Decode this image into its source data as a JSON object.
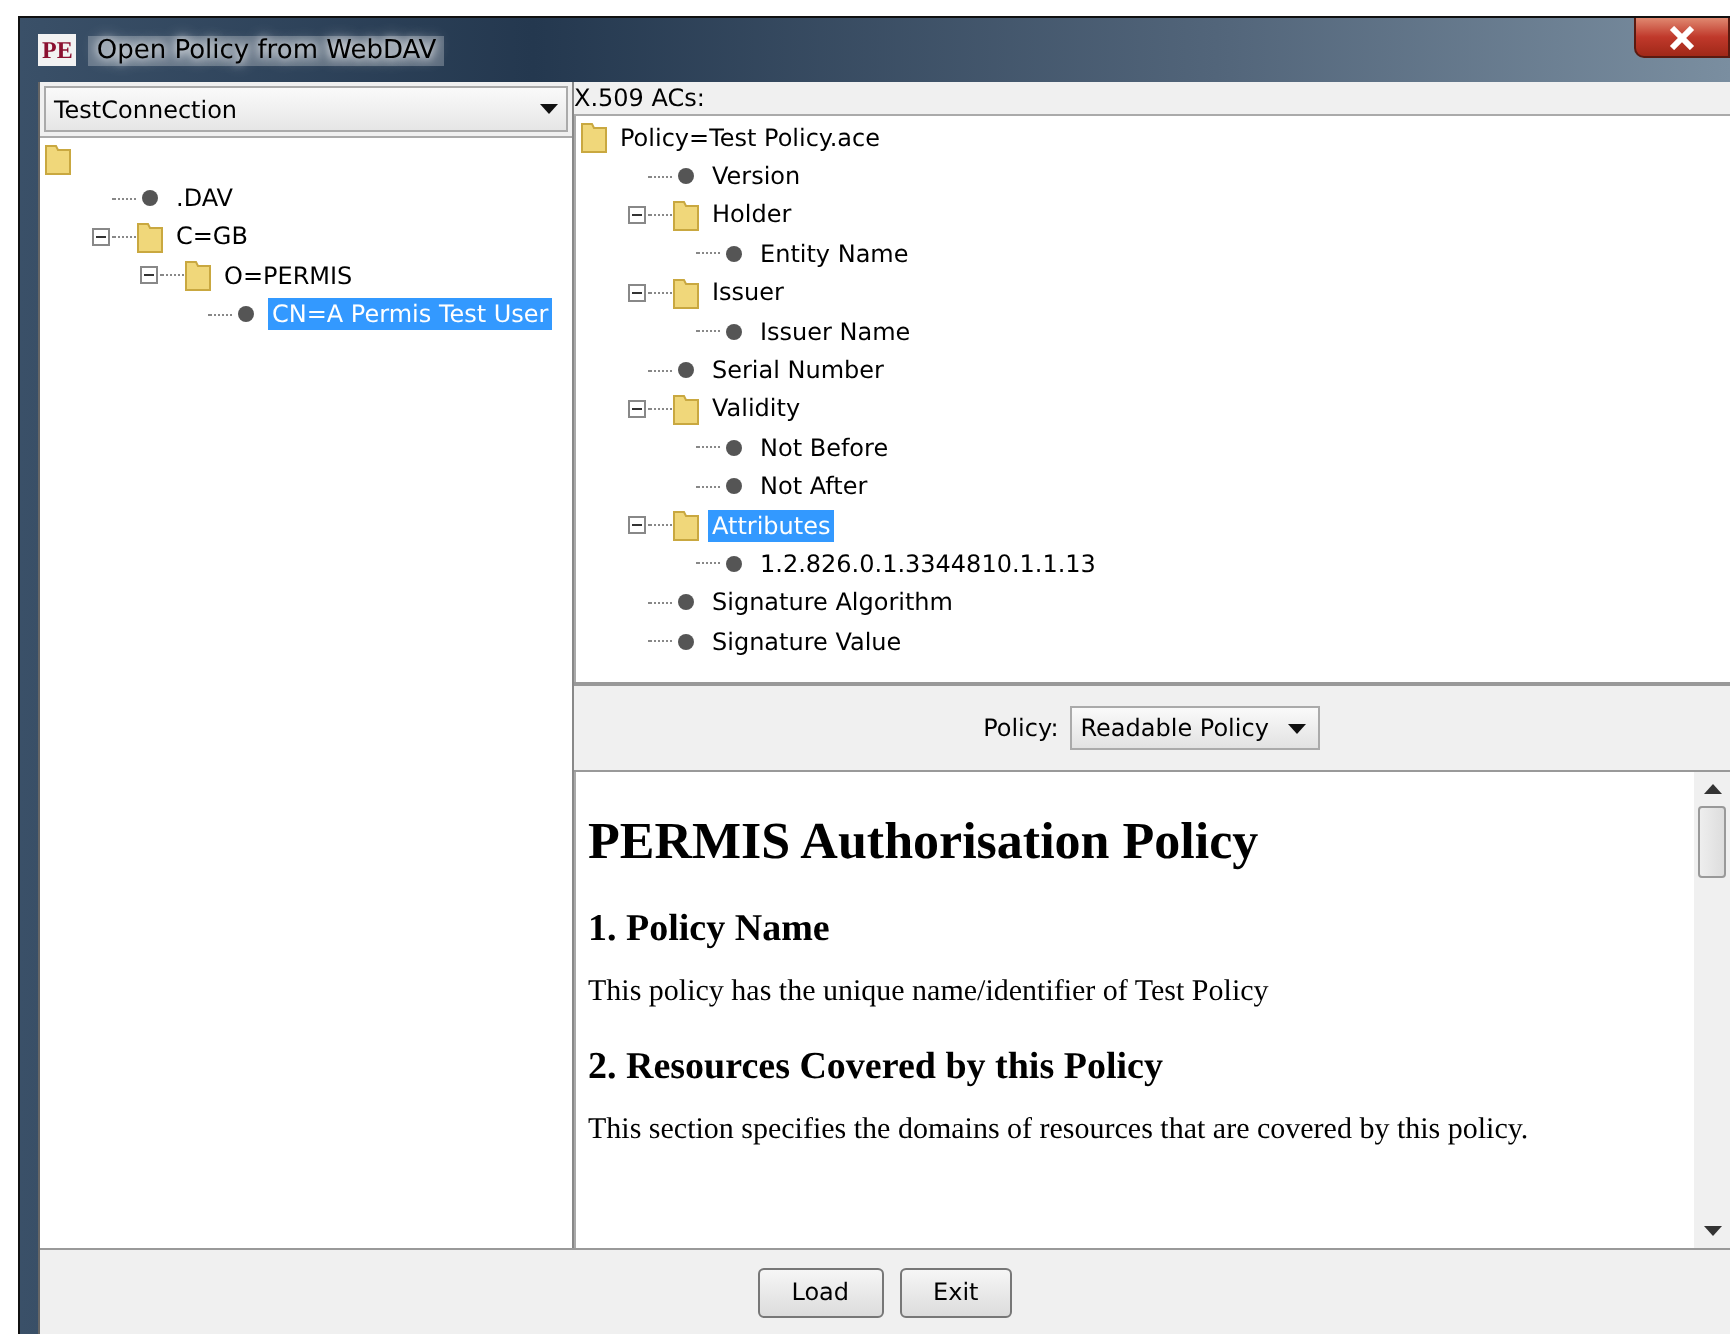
{
  "window": {
    "logo": "PE",
    "title": "Open Policy from WebDAV"
  },
  "connection": {
    "value": "TestConnection"
  },
  "left_tree": {
    "nodes": [
      {
        "kind": "folder",
        "selected": false,
        "children": [
          {
            "kind": "leaf",
            "label": ".DAV",
            "selected": false
          },
          {
            "kind": "folder",
            "label": "C=GB",
            "expanded": true,
            "selected": false,
            "children": [
              {
                "kind": "folder",
                "label": "O=PERMIS",
                "expanded": true,
                "selected": false,
                "children": [
                  {
                    "kind": "leaf",
                    "label": "CN=A Permis Test User",
                    "selected": true
                  }
                ]
              }
            ]
          }
        ]
      }
    ]
  },
  "ac_tree": {
    "label": "X.509 ACs:",
    "nodes": [
      {
        "kind": "folder",
        "label": "Policy=Test Policy.ace",
        "selected": false,
        "children": [
          {
            "kind": "leaf",
            "label": "Version",
            "selected": false
          },
          {
            "kind": "folder",
            "label": "Holder",
            "expanded": true,
            "selected": false,
            "children": [
              {
                "kind": "leaf",
                "label": "Entity Name",
                "selected": false
              }
            ]
          },
          {
            "kind": "folder",
            "label": "Issuer",
            "expanded": true,
            "selected": false,
            "children": [
              {
                "kind": "leaf",
                "label": "Issuer Name",
                "selected": false
              }
            ]
          },
          {
            "kind": "leaf",
            "label": "Serial Number",
            "selected": false
          },
          {
            "kind": "folder",
            "label": "Validity",
            "expanded": true,
            "selected": false,
            "children": [
              {
                "kind": "leaf",
                "label": "Not Before",
                "selected": false
              },
              {
                "kind": "leaf",
                "label": "Not After",
                "selected": false
              }
            ]
          },
          {
            "kind": "folder",
            "label": "Attributes",
            "expanded": true,
            "selected": true,
            "children": [
              {
                "kind": "leaf",
                "label": "1.2.826.0.1.3344810.1.1.13",
                "selected": false
              }
            ]
          },
          {
            "kind": "leaf",
            "label": "Signature Algorithm",
            "selected": false
          },
          {
            "kind": "leaf",
            "label": "Signature Value",
            "selected": false
          }
        ]
      }
    ]
  },
  "policy_view": {
    "label": "Policy:",
    "value": "Readable Policy"
  },
  "document": [
    {
      "kind": "h1",
      "text": "PERMIS Authorisation Policy"
    },
    {
      "kind": "h2",
      "text": "1. Policy Name"
    },
    {
      "kind": "p",
      "text": "This policy has the unique name/identifier of Test Policy"
    },
    {
      "kind": "h2",
      "text": "2. Resources Covered by this Policy"
    },
    {
      "kind": "p",
      "text": "This section specifies the domains of resources that are covered by this policy."
    }
  ],
  "buttons": [
    "Load",
    "Exit"
  ]
}
